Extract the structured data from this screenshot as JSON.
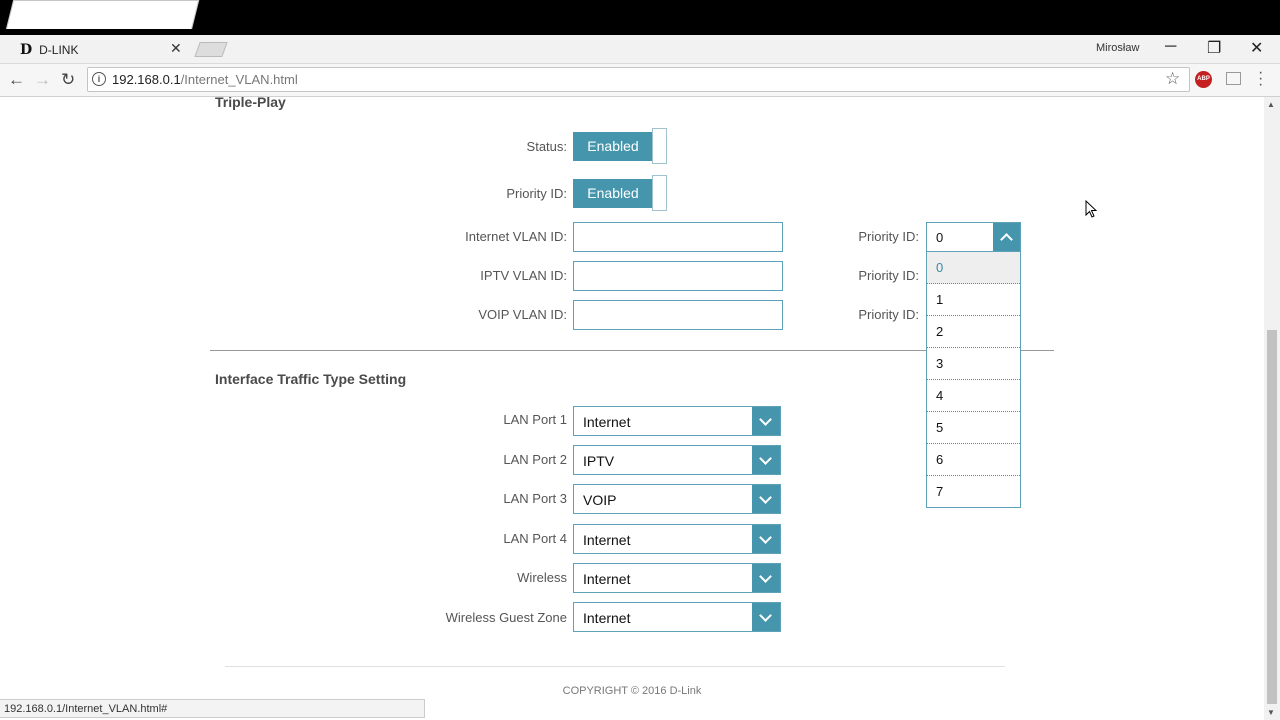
{
  "browser": {
    "tab_title": "D-LINK",
    "favicon_letter": "D",
    "user_name": "Mirosław",
    "url_host": "192.168.0.1",
    "url_path": "/Internet_VLAN.html",
    "status_url": "192.168.0.1/Internet_VLAN.html#"
  },
  "triple_play": {
    "title": "Triple-Play",
    "status_label": "Status:",
    "status_value": "Enabled",
    "priority_label": "Priority ID:",
    "priority_value": "Enabled",
    "internet_vlan_label": "Internet VLAN ID:",
    "iptv_vlan_label": "IPTV VLAN ID:",
    "voip_vlan_label": "VOIP VLAN ID:",
    "internet_vlan_value": "",
    "iptv_vlan_value": "",
    "voip_vlan_value": "",
    "prio_label_1": "Priority ID:",
    "prio_label_2": "Priority ID:",
    "prio_label_3": "Priority ID:",
    "prio_selected": "0",
    "prio_options": [
      "0",
      "1",
      "2",
      "3",
      "4",
      "5",
      "6",
      "7"
    ]
  },
  "traffic": {
    "title": "Interface Traffic Type Setting",
    "rows": [
      {
        "label": "LAN Port 1",
        "value": "Internet"
      },
      {
        "label": "LAN Port 2",
        "value": "IPTV"
      },
      {
        "label": "LAN Port 3",
        "value": "VOIP"
      },
      {
        "label": "LAN Port 4",
        "value": "Internet"
      },
      {
        "label": "Wireless",
        "value": "Internet"
      },
      {
        "label": "Wireless Guest Zone",
        "value": "Internet"
      }
    ]
  },
  "footer": {
    "copyright": "COPYRIGHT © 2016 D-Link"
  },
  "colors": {
    "accent": "#4596ad",
    "border": "#5da2b7"
  }
}
